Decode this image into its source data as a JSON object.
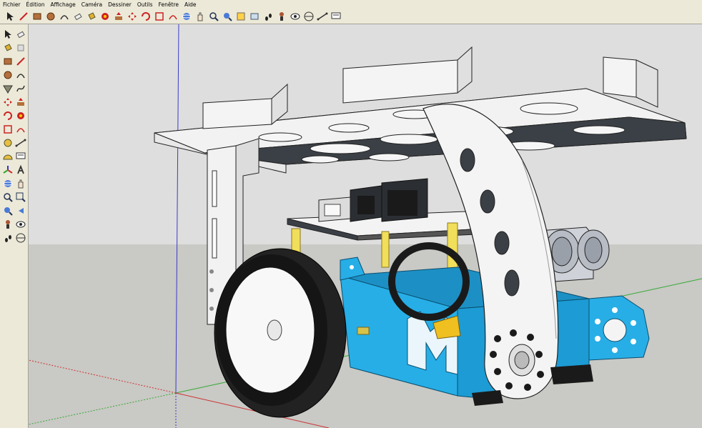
{
  "menu": {
    "items": [
      "Fichier",
      "Édition",
      "Affichage",
      "Caméra",
      "Dessiner",
      "Outils",
      "Fenêtre",
      "Aide"
    ]
  },
  "toolbar_icons": [
    "select-icon",
    "line-icon",
    "rectangle-icon",
    "circle-icon",
    "arc-icon",
    "eraser-icon",
    "paint-bucket-icon",
    "follow-me-icon",
    "push-pull-icon",
    "move-icon",
    "rotate-icon",
    "scale-icon",
    "offset-icon",
    "orbit-icon",
    "pan-icon",
    "zoom-icon",
    "zoom-extents-icon",
    "component-icon",
    "previous-view-icon",
    "walk-icon",
    "position-camera-icon",
    "look-around-icon",
    "section-plane-icon",
    "dimension-icon",
    "text-icon"
  ],
  "sidebar_icons": [
    "select-icon",
    "eraser-icon",
    "paint-bucket-icon",
    "make-component-icon",
    "rectangle-icon",
    "line-icon",
    "circle-icon",
    "arc-icon",
    "polygon-icon",
    "freehand-icon",
    "move-icon",
    "push-pull-icon",
    "rotate-icon",
    "follow-me-icon",
    "scale-icon",
    "offset-icon",
    "tape-measure-icon",
    "dimension-icon",
    "protractor-icon",
    "text-icon",
    "axes-icon",
    "3d-text-icon",
    "orbit-icon",
    "pan-icon",
    "zoom-icon",
    "zoom-window-icon",
    "zoom-extents-icon",
    "previous-icon",
    "position-camera-icon",
    "look-around-icon",
    "walk-icon",
    "section-plane-icon"
  ],
  "colors": {
    "sky": "#dcdcdc",
    "ground": "#c8c8c4",
    "chassis_blue": "#1fa8e4",
    "plate_dark": "#3a3f44",
    "bracket_white": "#f2f2f2",
    "wheel_black": "#1a1a1a",
    "sensor_grey": "#b8bcc4",
    "axis_red": "#cc3333",
    "axis_green": "#33aa33",
    "axis_blue": "#3333cc"
  }
}
